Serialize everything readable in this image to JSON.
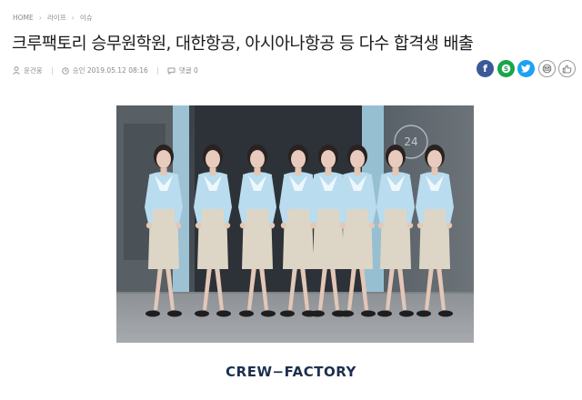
{
  "breadcrumb": {
    "items": [
      "HOME",
      "라이프",
      "이슈"
    ],
    "separator": "›"
  },
  "article": {
    "title": "크루팩토리 승무원학원, 대한항공, 아시아나항공 등 다수 합격생 배출",
    "author": "윤건웅",
    "date": "승인 2019.05.12 08:16",
    "comments": "댓글 0"
  },
  "share": [
    {
      "name": "facebook-icon",
      "color": "#3b5998"
    },
    {
      "name": "kakaostory-icon",
      "color": "#19a548"
    },
    {
      "name": "twitter-icon",
      "color": "#1da1f2"
    },
    {
      "name": "email-icon",
      "color": "#ffffff"
    },
    {
      "name": "like-icon",
      "color": "#ffffff"
    }
  ],
  "photo": {
    "sign": "24",
    "people": 8
  },
  "logo": {
    "text": "CREW−FACTORY",
    "color": "#1c2f4f"
  },
  "colors": {
    "text": "#1a1a1a",
    "meta": "#8a8a8a",
    "uniform_blouse": "#b9dcef",
    "uniform_skirt": "#ddd6c7"
  }
}
